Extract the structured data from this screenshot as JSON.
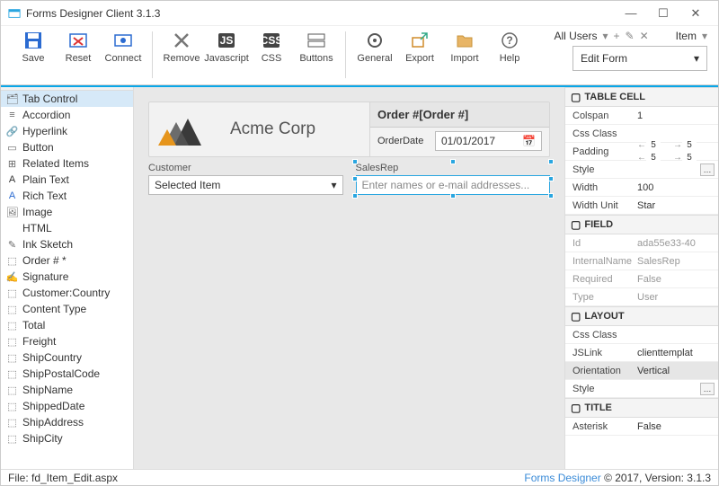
{
  "window": {
    "title": "Forms Designer Client 3.1.3"
  },
  "ribbon": {
    "groups": [
      [
        {
          "icon": "save",
          "label": "Save",
          "color": "#2b6bd1"
        },
        {
          "icon": "reset",
          "label": "Reset",
          "color": "#d33"
        },
        {
          "icon": "connect",
          "label": "Connect",
          "color": "#2b6bd1"
        }
      ],
      [
        {
          "icon": "remove",
          "label": "Remove",
          "color": "#777"
        },
        {
          "icon": "js",
          "label": "Javascript",
          "color": "#333"
        },
        {
          "icon": "css",
          "label": "CSS",
          "color": "#333"
        },
        {
          "icon": "buttons",
          "label": "Buttons",
          "color": "#333"
        }
      ],
      [
        {
          "icon": "general",
          "label": "General",
          "color": "#555"
        },
        {
          "icon": "export",
          "label": "Export",
          "color": "#d08b2a"
        },
        {
          "icon": "import",
          "label": "Import",
          "color": "#d08b2a"
        },
        {
          "icon": "help",
          "label": "Help",
          "color": "#666"
        }
      ]
    ],
    "right": {
      "users": "All Users",
      "item": "Item",
      "formtype": "Edit Form"
    }
  },
  "toolbox": [
    {
      "icon": "tab",
      "label": "Tab Control",
      "sel": true
    },
    {
      "icon": "acc",
      "label": "Accordion"
    },
    {
      "icon": "link",
      "label": "Hyperlink"
    },
    {
      "icon": "btn",
      "label": "Button"
    },
    {
      "icon": "rel",
      "label": "Related Items"
    },
    {
      "icon": "txt",
      "label": "Plain Text"
    },
    {
      "icon": "rtf",
      "label": "Rich Text"
    },
    {
      "icon": "img",
      "label": "Image"
    },
    {
      "icon": "html",
      "label": "HTML"
    },
    {
      "icon": "ink",
      "label": "Ink Sketch"
    },
    {
      "icon": "fld",
      "label": "Order # *"
    },
    {
      "icon": "sig",
      "label": "Signature"
    },
    {
      "icon": "fld",
      "label": "Customer:Country"
    },
    {
      "icon": "fld",
      "label": "Content Type"
    },
    {
      "icon": "fld",
      "label": "Total"
    },
    {
      "icon": "fld",
      "label": "Freight"
    },
    {
      "icon": "fld",
      "label": "ShipCountry"
    },
    {
      "icon": "fld",
      "label": "ShipPostalCode"
    },
    {
      "icon": "fld",
      "label": "ShipName"
    },
    {
      "icon": "fld",
      "label": "ShippedDate"
    },
    {
      "icon": "fld",
      "label": "ShipAddress"
    },
    {
      "icon": "fld",
      "label": "ShipCity"
    }
  ],
  "canvas": {
    "company": "Acme Corp",
    "orderHeader": "Order #[Order #]",
    "orderDateLbl": "OrderDate",
    "orderDate": "01/01/2017",
    "customerLbl": "Customer",
    "customerVal": "Selected Item",
    "salesRepLbl": "SalesRep",
    "salesRepPh": "Enter names or e-mail addresses..."
  },
  "props": {
    "tablecell": {
      "title": "TABLE CELL",
      "Colspan": "1",
      "CssClass": "",
      "Padding": [
        "5",
        "5",
        "5",
        "5"
      ],
      "Style": "",
      "Width": "100",
      "WidthUnit": "Star"
    },
    "field": {
      "title": "FIELD",
      "Id": "ada55e33-40",
      "InternalName": "SalesRep",
      "Required": "False",
      "Type": "User"
    },
    "layout": {
      "title": "LAYOUT",
      "CssClass": "",
      "JSLink": "clienttemplat",
      "Orientation": "Vertical",
      "Style": ""
    },
    "titlegrp": {
      "title": "TITLE",
      "Asterisk": "False"
    }
  },
  "status": {
    "file": "File:  fd_Item_Edit.aspx",
    "copyright": "Forms Designer © 2017, Version: 3.1.3",
    "link": "Forms Designer"
  }
}
